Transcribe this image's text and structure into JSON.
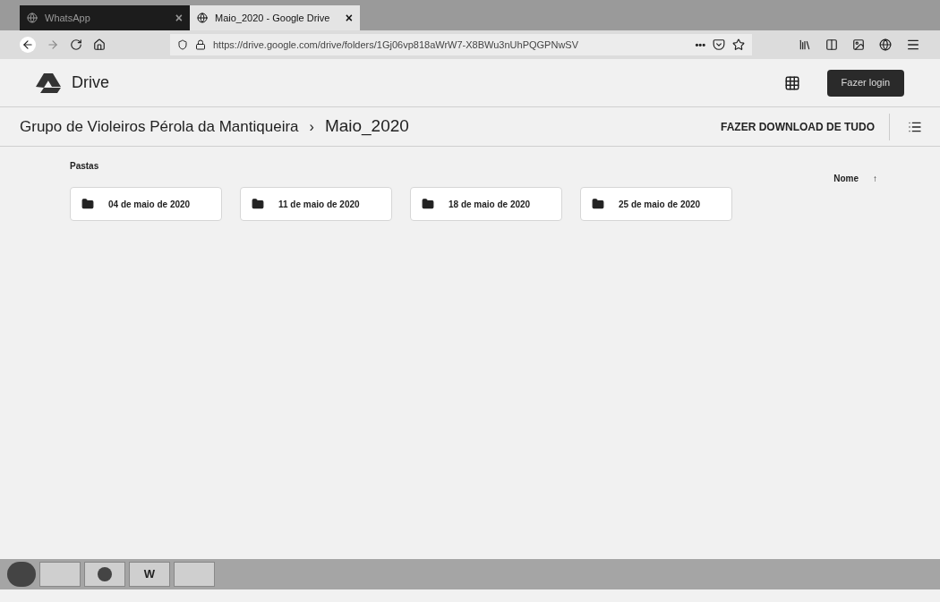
{
  "browser": {
    "tabs": [
      {
        "title": "WhatsApp",
        "selected": false,
        "close": "×"
      },
      {
        "title": "Maio_2020 - Google Drive",
        "selected": true,
        "close": "×"
      }
    ],
    "url": "https://drive.google.com/drive/folders/1Gj06vp818aWrW7-X8BWu3nUhPQGPNwSV",
    "more": "•••"
  },
  "header": {
    "app_name": "Drive",
    "login_button": "Fazer login"
  },
  "breadcrumb": [
    {
      "label": "Grupo de Violeiros Pérola da Mantiqueira"
    },
    {
      "label": "Maio_2020"
    }
  ],
  "breadcrumb_separator": "›",
  "download_all": "FAZER DOWNLOAD DE TUDO",
  "section_title": "Pastas",
  "sort": {
    "label": "Nome",
    "arrow": "↑"
  },
  "folders": [
    {
      "name": "04 de maio de 2020"
    },
    {
      "name": "11 de maio de 2020"
    },
    {
      "name": "18 de maio de 2020"
    },
    {
      "name": "25 de maio de 2020"
    }
  ],
  "taskbar": {
    "word_label": "W"
  }
}
